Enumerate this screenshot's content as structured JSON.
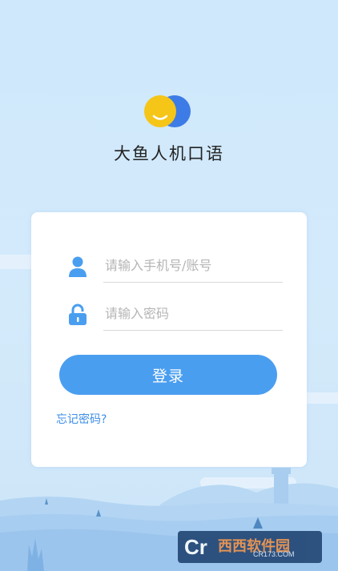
{
  "app": {
    "name": "大鱼人机口语"
  },
  "login_form": {
    "account_placeholder": "请输入手机号/账号",
    "account_value": "",
    "password_placeholder": "请输入密码",
    "password_value": "",
    "login_label": "登录",
    "forgot_label": "忘记密码?"
  },
  "icons": {
    "logo": "smiley-bubble-logo",
    "account": "user-icon",
    "password": "lock-icon"
  },
  "colors": {
    "accent": "#4a9ef0",
    "logo_yellow": "#f5c518",
    "logo_blue": "#3d7be6",
    "background": "#d3eafb"
  },
  "watermark": {
    "mark": "Cr",
    "brand": "西西软件园",
    "site": "CR173.COM"
  }
}
